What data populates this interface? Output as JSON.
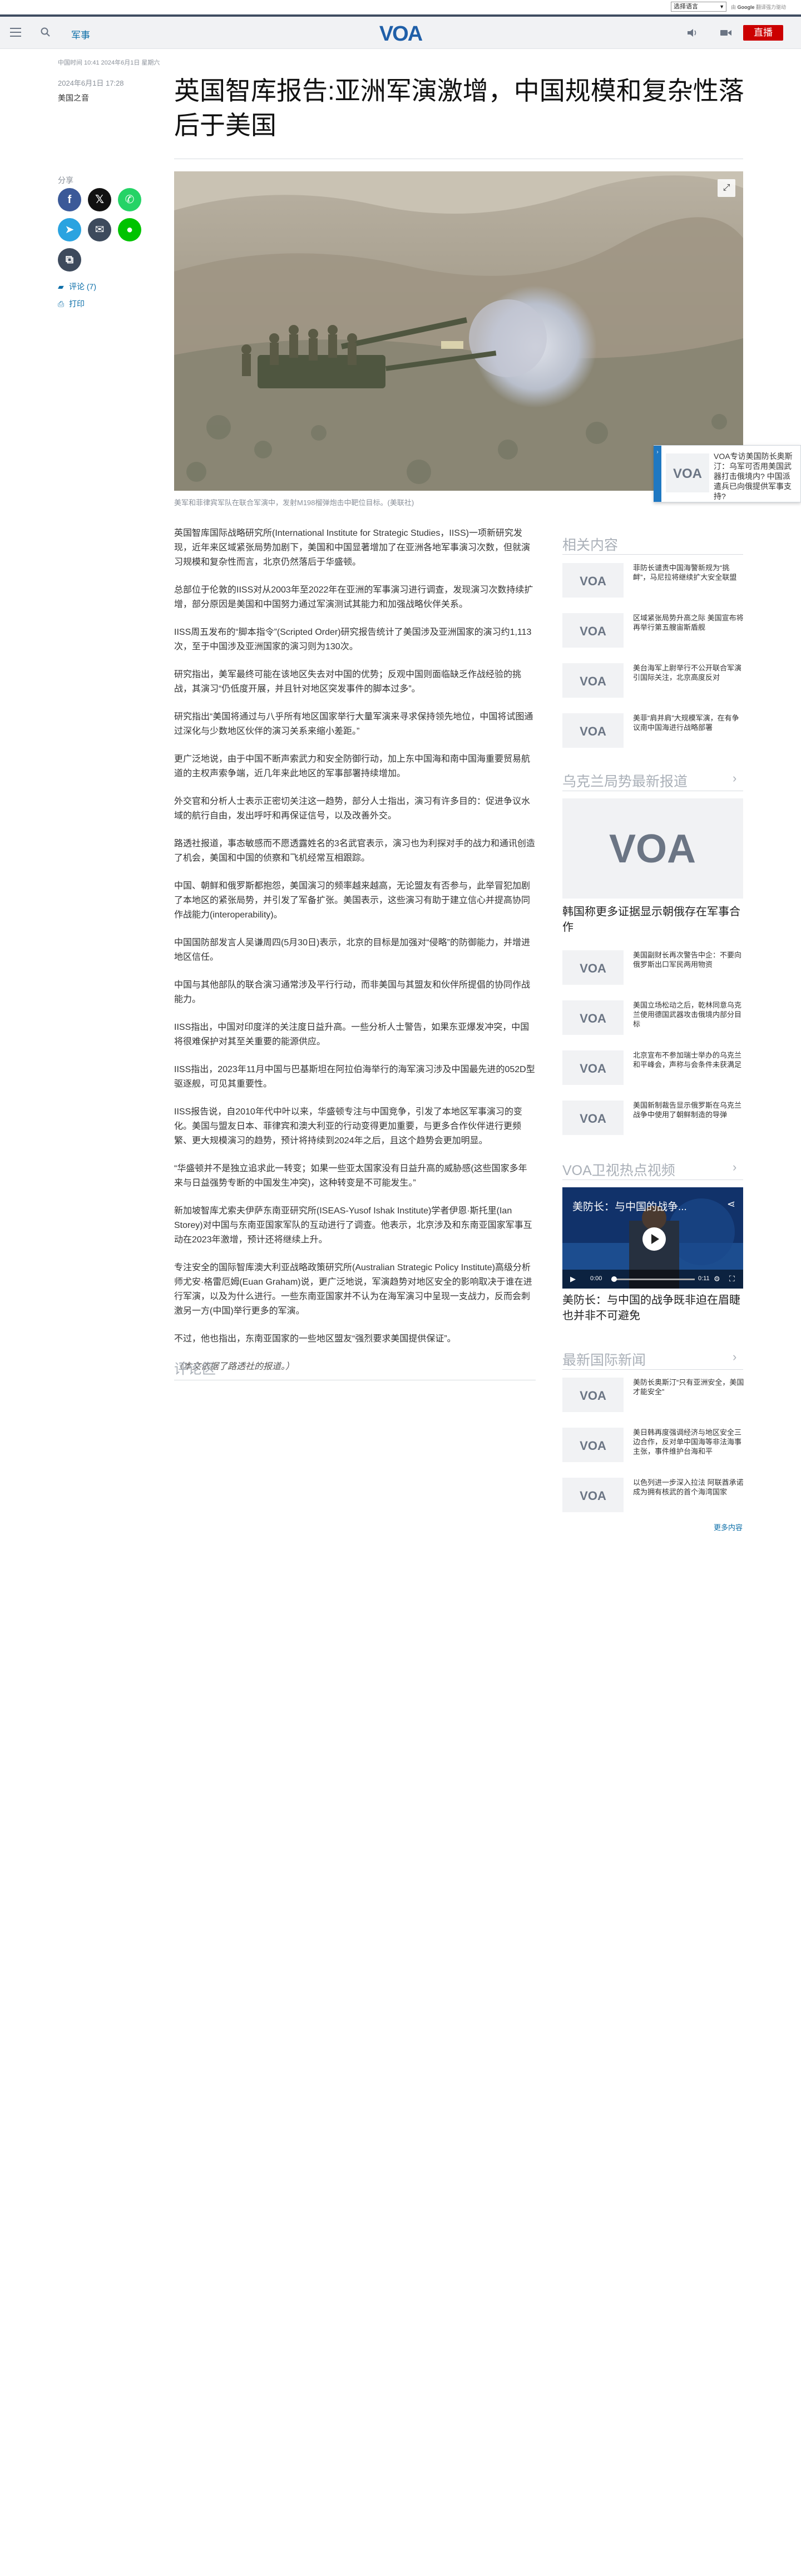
{
  "translate": {
    "select_label": "选择语言",
    "powered_prefix": "由",
    "powered_brand": "Google",
    "powered_suffix": "翻译强力驱动"
  },
  "header": {
    "section": "军事",
    "logo_text": "VOA",
    "live_label": "直播"
  },
  "timeline": "中国时间 10:41 2024年6月1日 星期六",
  "article": {
    "date": "2024年6月1日 17:28",
    "source": "美国之音",
    "title": "英国智库报告:亚洲军演激增，中国规模和复杂性落后于美国",
    "caption": "美军和菲律宾军队在联合军演中，发射M198榴弹炮击中靶位目标。(美联社)",
    "paragraphs": [
      "英国智库国际战略研究所(International Institute for Strategic Studies，IISS)一项新研究发现，近年来区域紧张局势加剧下，美国和中国显著增加了在亚洲各地军事演习次数，但就演习规模和复杂性而言，北京仍然落后于华盛顿。",
      "总部位于伦敦的IISS对从2003年至2022年在亚洲的军事演习进行调查，发现演习次数持续扩增，部分原因是美国和中国努力通过军演测试其能力和加强战略伙伴关系。",
      "IISS周五发布的“脚本指令”(Scripted Order)研究报告统计了美国涉及亚洲国家的演习约1,113次，至于中国涉及亚洲国家的演习则为130次。",
      "研究指出，美军最终可能在该地区失去对中国的优势；反观中国则面临缺乏作战经验的挑战，其演习“仍低度开展，并且针对地区突发事件的脚本过多”。",
      "研究指出“美国将通过与八乎所有地区国家举行大量军演来寻求保持领先地位，中国将试图通过深化与少数地区伙伴的演习关系来缩小差距。”",
      "更广泛地说，由于中国不断声索武力和安全防御行动，加上东中国海和南中国海重要贸易航道的主权声索争端，近几年来此地区的军事部署持续增加。",
      "外交官和分析人士表示正密切关注这一趋势，部分人士指出，演习有许多目的：促进争议水域的航行自由，发出呼吁和再保证信号，以及改善外交。",
      "路透社报道，事态敏感而不愿透露姓名的3名武官表示，演习也为利探对手的战力和通讯创造了机会，美国和中国的侦察和飞机经常互相跟踪。",
      "中国、朝鲜和俄罗斯都抱怨，美国演习的频率越来越高，无论盟友有否参与，此举冒犯加剧了本地区的紧张局势，并引发了军备扩张。美国表示，这些演习有助于建立信心并提高协同作战能力(interoperability)。",
      "中国国防部发言人吴谦周四(5月30日)表示，北京的目标是加强对“侵略”的防御能力，并增进地区信任。",
      "中国与其他部队的联合演习通常涉及平行行动，而非美国与其盟友和伙伴所提倡的协同作战能力。",
      "IISS指出，中国对印度洋的关注度日益升高。一些分析人士警告，如果东亚爆发冲突，中国将很难保护对其至关重要的能源供应。",
      "IISS指出，2023年11月中国与巴基斯坦在阿拉伯海举行的海军演习涉及中国最先进的052D型驱逐舰，可见其重要性。",
      "IISS报告说，自2010年代中叶以来，华盛顿专注与中国竞争，引发了本地区军事演习的变化。美国与盟友日本、菲律宾和澳大利亚的行动变得更加重要，与更多合作伙伴进行更频繁、更大规模演习的趋势，预计将持续到2024年之后，且这个趋势会更加明显。",
      "“华盛顿并不是独立追求此一转变；如果一些亚太国家没有日益升高的威胁感(这些国家多年来与日益强势专断的中国发生冲突)，这种转变是不可能发生。”",
      "新加坡智库尤索夫伊萨东南亚研究所(ISEAS-Yusof Ishak Institute)学者伊恩·斯托里(Ian Storey)对中国与东南亚国家军队的互动进行了调查。他表示，北京涉及和东南亚国家军事互动在2023年激增，预计还将继续上升。",
      "专注安全的国际智库澳大利亚战略政策研究所(Australian Strategic Policy Institute)高级分析师尤安·格雷厄姆(Euan Graham)说，更广泛地说，军演趋势对地区安全的影响取决于谁在进行军演，以及为什么进行。一些东南亚国家并不认为在海军演习中呈现一支战力，反而会刺激另一方(中国)举行更多的军演。",
      "不过，他也指出，东南亚国家的一些地区盟友“强烈要求美国提供保证”。",
      "（本文依据了路透社的报道。）"
    ],
    "comments_label": "评论区"
  },
  "share": {
    "label": "分享",
    "comments_link": "评论 (7)",
    "print_link": "打印",
    "buttons": [
      {
        "icon": "facebook-icon",
        "glyph": "f",
        "color": "#3b5998"
      },
      {
        "icon": "x-icon",
        "glyph": "𝕏",
        "color": "#111111"
      },
      {
        "icon": "whatsapp-icon",
        "glyph": "✆",
        "color": "#25d366"
      },
      {
        "icon": "telegram-icon",
        "glyph": "➤",
        "color": "#2aa3e0"
      },
      {
        "icon": "email-icon",
        "glyph": "✉",
        "color": "#3d4a5c"
      },
      {
        "icon": "line-icon",
        "glyph": "●",
        "color": "#00c300"
      },
      {
        "icon": "copy-link-icon",
        "glyph": "⧉",
        "color": "#3d4a5c"
      }
    ]
  },
  "float_card": {
    "text": "VOA专访美国防长奥斯汀：乌军可否用美国武器打击俄境内? 中国派遣兵已向俄提供军事支持?"
  },
  "sidebar": {
    "related": {
      "heading": "相关内容",
      "items": [
        "菲防长谴责中国海警新规为“挑衅”，马尼拉将继续扩大安全联盟",
        "区域紧张局势升高之际 美国宣布将再举行第五艘宙斯盾舰",
        "美台海军上尉举行不公开联合军演引国际关注，北京高度反对",
        "美菲“肩并肩”大规模军演，在有争议南中国海进行战略部署"
      ]
    },
    "ukraine": {
      "heading": "乌克兰局势最新报道",
      "top_title": "韩国称更多证据显示朝俄存在军事合作",
      "items": [
        "美国副财长再次警告中企：不要向俄罗斯出口军民两用物资",
        "美国立场松动之后，乾林同意乌克兰使用德国武器攻击俄境内部分目标",
        "北京宣布不参加瑞士举办的乌克兰和平峰会，声称与会条件未获满足",
        "美国新制裁告显示俄罗斯在乌克兰战争中使用了朝鲜制造的导弹"
      ]
    },
    "video": {
      "heading": "VOA卫视热点视频",
      "player_title": "美防长：与中国的战争...",
      "time_current": "0:00",
      "time_total": "0:11",
      "title": "美防长：与中国的战争既非迫在眉睫也并非不可避免"
    },
    "intl": {
      "heading": "最新国际新闻",
      "items": [
        "美防长奥斯汀“只有亚洲安全，美国才能安全”",
        "美日韩再度强调经济与地区安全三边合作，反对单中国海等非法海事主张，事件维护台海和平",
        "以色列进一步深入拉法 阿联酋承诺成为拥有核武的首个海湾国家"
      ]
    },
    "more_link": "更多内容"
  },
  "colors": {
    "brand_blue": "#1f5fa8",
    "link_blue": "#0b6ea8",
    "live_red": "#cc0000",
    "header_bg": "#f1f2f4"
  }
}
